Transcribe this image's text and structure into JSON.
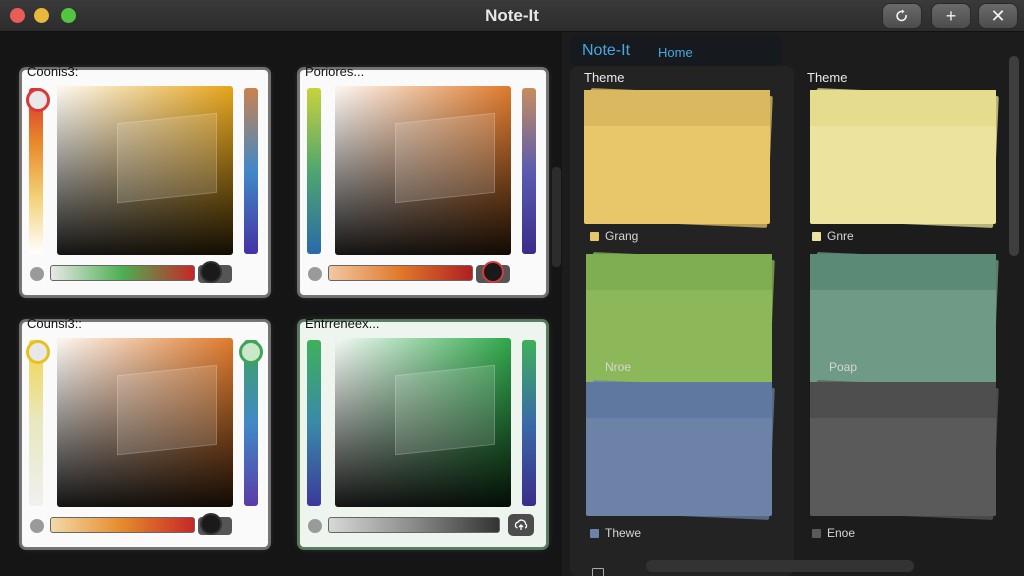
{
  "window": {
    "title": "Note-It",
    "buttons": {
      "refresh_icon": "refresh-icon",
      "add_label": "+",
      "close_label": "✕"
    }
  },
  "pickers": [
    {
      "label": "Coonis3:",
      "colors": {
        "hue": "#e6a41a",
        "left_slider": [
          "#d82e2e",
          "#e88a2a",
          "#f3d27a",
          "#ffffff"
        ],
        "right_slider": [
          "#c9834f",
          "#4189c8",
          "#4532a5"
        ],
        "bar": [
          "#e8e8e8",
          "#4caf50",
          "#c62828"
        ]
      }
    },
    {
      "label": "Poriores...",
      "colors": {
        "hue": "#e07a2c",
        "left_slider": [
          "#c8d23c",
          "#4fa66e",
          "#2a6aa8"
        ],
        "right_slider": [
          "#c58e5e",
          "#5b5bb0",
          "#3a2c8a"
        ],
        "bar": [
          "#f2c8a0",
          "#e0782a",
          "#b02020"
        ]
      }
    },
    {
      "label": "Counsi3::",
      "colors": {
        "hue": "#e07a2c",
        "left_slider": [
          "#f2d44a",
          "#e8e8c0",
          "#f0f0f0"
        ],
        "right_slider": [
          "#3fa35a",
          "#4189c8",
          "#5a3ca8"
        ],
        "bar": [
          "#f3d9a8",
          "#e58a2a",
          "#c62828"
        ]
      }
    },
    {
      "label": "Entrreneex...",
      "colors": {
        "hue": "#2ea84a",
        "left_slider": [
          "#3fb05a",
          "#3a8aa8",
          "#3a3a9a"
        ],
        "right_slider": [
          "#3fb05a",
          "#3a6aa8",
          "#3a2c8a"
        ],
        "bar": [
          "#d8d8d8",
          "#8a8a8a",
          "#333333"
        ]
      }
    }
  ],
  "sidebar": {
    "app": "Note-It",
    "breadcrumb": "Home",
    "columns": [
      "Theme",
      "Theme"
    ],
    "themes": [
      {
        "name": "Grang",
        "color": "#e7c76a",
        "band": "#d9b860"
      },
      {
        "name": "Gnre",
        "color": "#ece49e",
        "band": "#e6dc8e"
      },
      {
        "name": "Nroe",
        "color": "#8cb85a",
        "band": "#7fae52"
      },
      {
        "name": "Poap",
        "color": "#6f9a86",
        "band": "#5b8a76"
      },
      {
        "name": "Thewe",
        "color": "#6c82a6",
        "band": "#5e78a0"
      },
      {
        "name": "Enoe",
        "color": "#5a5a5a",
        "band": "#4e4e4e"
      }
    ]
  }
}
